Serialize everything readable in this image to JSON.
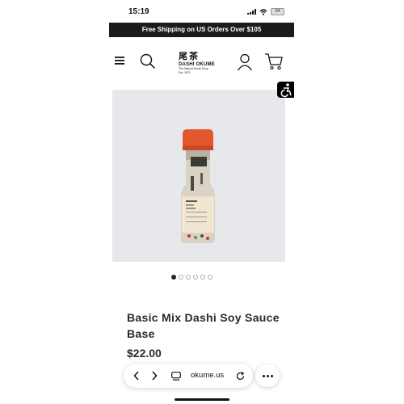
{
  "status_bar": {
    "time": "15:19",
    "battery": "24"
  },
  "banner": {
    "text": "Free Shipping on US Orders Over $105"
  },
  "header": {
    "logo_kanji": "尾茶",
    "logo_brand": "DASHI OKUME",
    "logo_tagline": "The Natural Broth Shop",
    "logo_est": "Est. 1871"
  },
  "product": {
    "title": "Basic Mix Dashi Soy Sauce Base",
    "price": "$22.00",
    "image_count": 6,
    "active_image": 0
  },
  "browser": {
    "url": "okume.us"
  },
  "colors": {
    "banner_bg": "#1b1b1b",
    "cap": "#e2572b",
    "image_bg": "#e6e8ec"
  }
}
